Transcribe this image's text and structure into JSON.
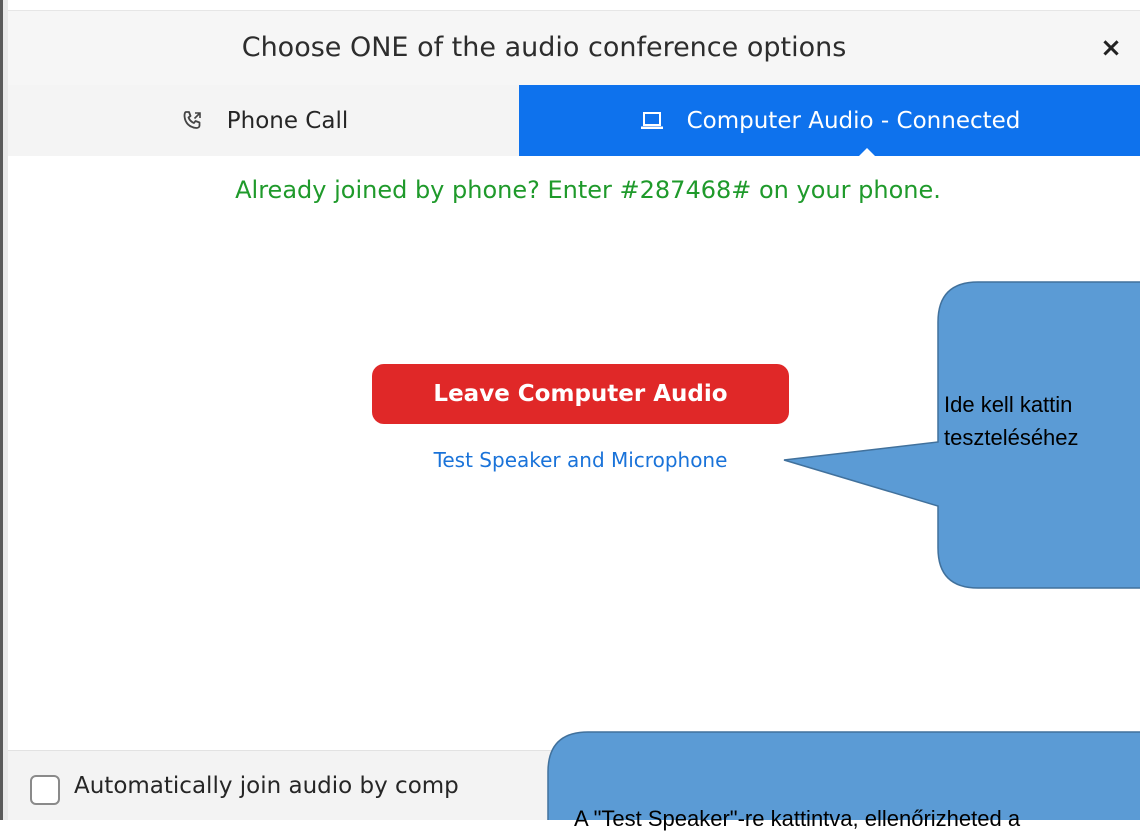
{
  "dialog": {
    "title": "Choose ONE of the audio conference options",
    "close_glyph": "×"
  },
  "tabs": [
    {
      "label": "Phone Call",
      "icon": "phone-icon",
      "active": false
    },
    {
      "label": "Computer Audio - Connected",
      "icon": "laptop-icon",
      "active": true
    }
  ],
  "main": {
    "notice": "Already joined by phone? Enter #287468# on your phone.",
    "leave_button": "Leave Computer Audio",
    "test_link": "Test Speaker and Microphone"
  },
  "footer": {
    "checkbox_checked": false,
    "checkbox_label": "Automatically join audio by comp"
  },
  "callouts": {
    "first_line1": "Ide kell kattin",
    "first_line2": "teszteléséhez",
    "second": "A \"Test Speaker\"-re kattintva, ellenőrizheted a"
  },
  "colors": {
    "accent": "#0e72ed",
    "danger": "#e02828",
    "notice_green": "#1f9a2b",
    "link": "#1a73d9",
    "callout_fill": "#5b9bd5",
    "callout_stroke": "#41719c"
  }
}
